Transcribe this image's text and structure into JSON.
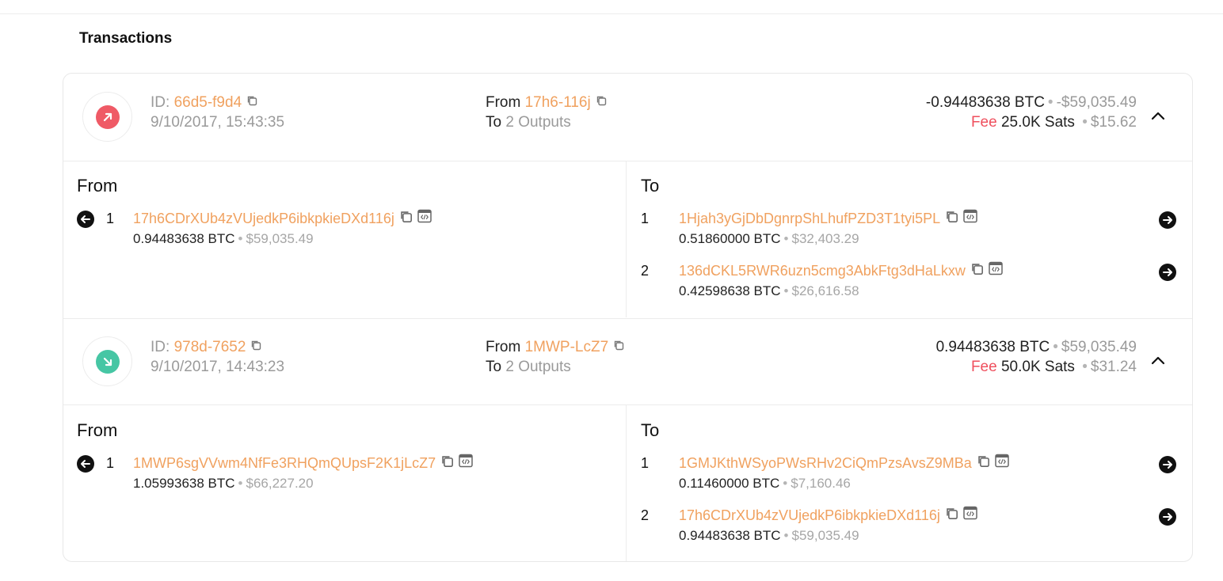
{
  "section_title": "Transactions",
  "colors": {
    "accent": "#f0a15f",
    "fee": "#ef4f5d",
    "outgoing": "#ef5a66",
    "incoming": "#46c6a4"
  },
  "transactions": [
    {
      "direction": "outgoing",
      "direction_icon": "arrow-up-right-icon",
      "id_label": "ID:",
      "id": "66d5-f9d4",
      "timestamp": "9/10/2017, 15:43:35",
      "from_label": "From",
      "from_short": "17h6-116j",
      "to_label": "To",
      "to_value": "2 Outputs",
      "amount_btc": "-0.94483638 BTC",
      "amount_usd": "-$59,035.49",
      "fee_label": "Fee",
      "fee_sats": "25.0K Sats",
      "fee_usd": "$15.62",
      "details": {
        "from_title": "From",
        "to_title": "To",
        "inputs": [
          {
            "index": "1",
            "address": "17h6CDrXUb4zVUjedkP6ibkpkieDXd116j",
            "btc": "0.94483638 BTC",
            "usd": "$59,035.49"
          }
        ],
        "outputs": [
          {
            "index": "1",
            "address": "1Hjah3yGjDbDgnrpShLhufPZD3T1tyi5PL",
            "btc": "0.51860000 BTC",
            "usd": "$32,403.29"
          },
          {
            "index": "2",
            "address": "136dCKL5RWR6uzn5cmg3AbkFtg3dHaLkxw",
            "btc": "0.42598638 BTC",
            "usd": "$26,616.58"
          }
        ]
      }
    },
    {
      "direction": "incoming",
      "direction_icon": "arrow-down-right-icon",
      "id_label": "ID:",
      "id": "978d-7652",
      "timestamp": "9/10/2017, 14:43:23",
      "from_label": "From",
      "from_short": "1MWP-LcZ7",
      "to_label": "To",
      "to_value": "2 Outputs",
      "amount_btc": "0.94483638 BTC",
      "amount_usd": "$59,035.49",
      "fee_label": "Fee",
      "fee_sats": "50.0K Sats",
      "fee_usd": "$31.24",
      "details": {
        "from_title": "From",
        "to_title": "To",
        "inputs": [
          {
            "index": "1",
            "address": "1MWP6sgVVwm4NfFe3RHQmQUpsF2K1jLcZ7",
            "btc": "1.05993638 BTC",
            "usd": "$66,227.20"
          }
        ],
        "outputs": [
          {
            "index": "1",
            "address": "1GMJKthWSyoPWsRHv2CiQmPzsAvsZ9MBa",
            "btc": "0.11460000 BTC",
            "usd": "$7,160.46"
          },
          {
            "index": "2",
            "address": "17h6CDrXUb4zVUjedkP6ibkpkieDXd116j",
            "btc": "0.94483638 BTC",
            "usd": "$59,035.49"
          }
        ]
      }
    }
  ]
}
